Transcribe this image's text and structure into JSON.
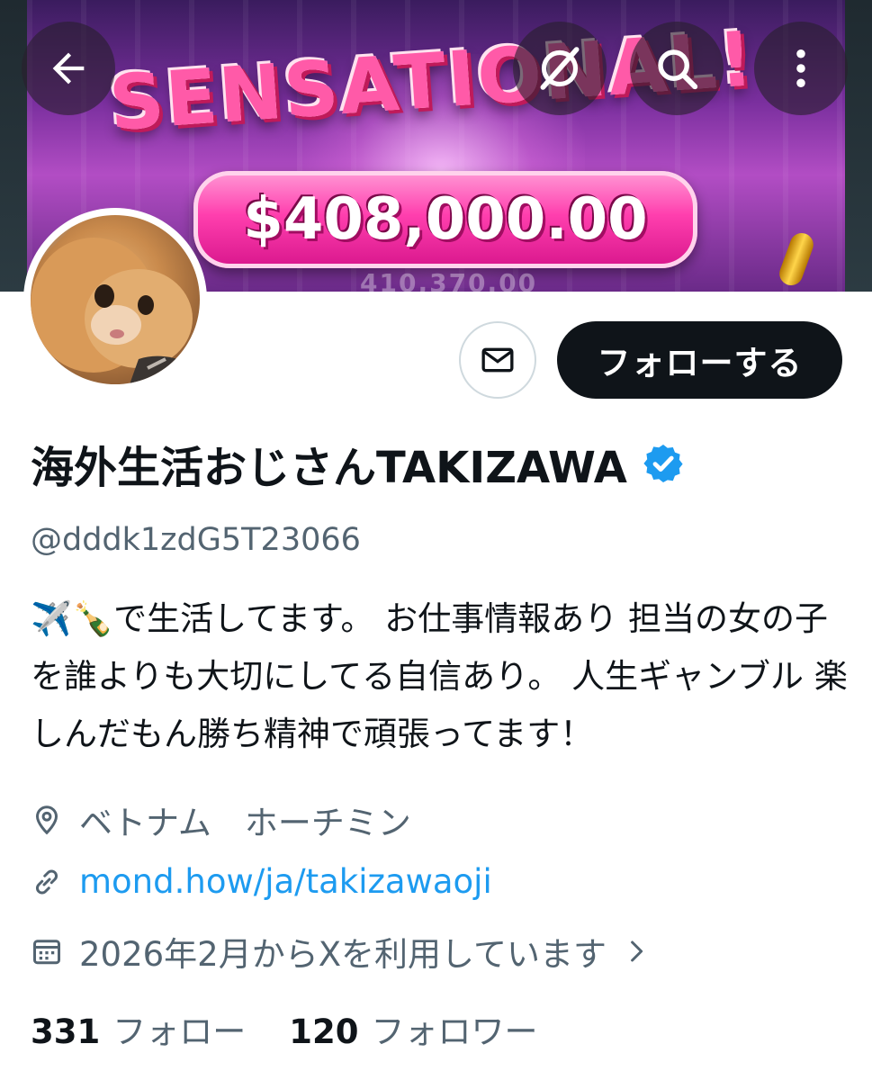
{
  "banner": {
    "title_text": "SENSATIONAL!",
    "amount_text": "$408,000.00",
    "sub_text": "410,370.00"
  },
  "topbar": {
    "back_icon": "arrow-left-icon",
    "grok_icon": "grok-icon",
    "search_icon": "search-icon",
    "more_icon": "more-vertical-icon"
  },
  "profile": {
    "display_name": "海外生活おじさんTAKIZAWA",
    "handle": "@dddk1zdG5T23066",
    "bio": "✈️🍾で生活してます。 お仕事情報あり 担当の女の子を誰よりも大切にしてる自信あり。 人生ギャンブル 楽しんだもん勝ち精神で頑張ってます！",
    "location": "ベトナム　ホーチミン",
    "link": "mond.how/ja/takizawaoji",
    "joined": "2026年2月からXを利用しています"
  },
  "actions": {
    "follow_label": "フォローする",
    "message_icon": "envelope-icon"
  },
  "stats": {
    "following_count": "331",
    "following_label": "フォロー",
    "followers_count": "120",
    "followers_label": "フォロワー"
  },
  "colors": {
    "accent": "#1d9bf0",
    "text_primary": "#0f1419",
    "text_secondary": "#536471",
    "follow_button_bg": "#0f1419"
  }
}
